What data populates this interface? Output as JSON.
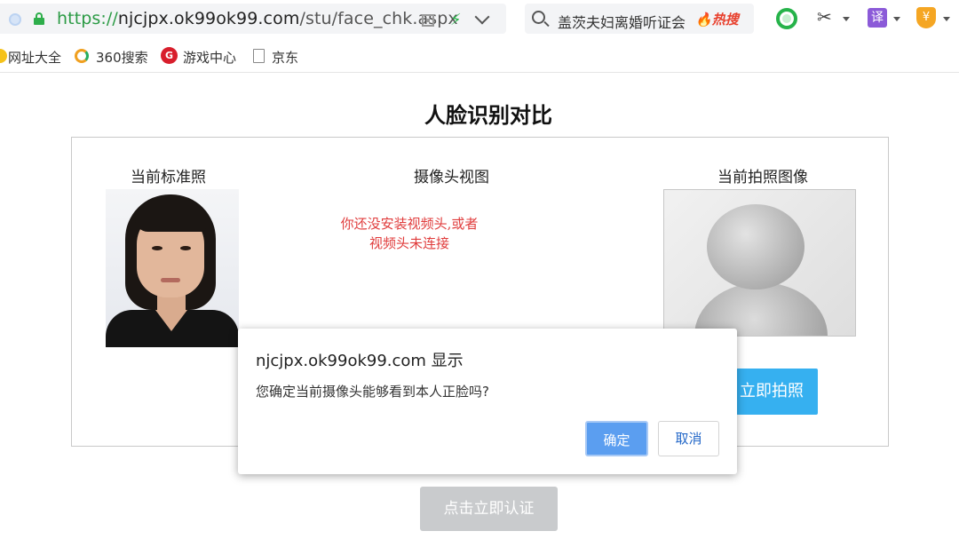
{
  "browser": {
    "url_scheme": "https://",
    "url_host": "njcjpx.ok99ok99.com",
    "url_path": "/stu/face_chk.aspx",
    "search_text": "盖茨夫妇离婚听证会",
    "search_hot": "热搜",
    "translate_label": "译",
    "wallet_label": "¥"
  },
  "bookmarks": {
    "items": [
      "网址大全",
      "360搜索",
      "游戏中心",
      "京东"
    ],
    "game_icon_letter": "G"
  },
  "page": {
    "title": "人脸识别对比",
    "standard_photo_label": "当前标准照",
    "camera_view_label": "摄像头视图",
    "camera_message_line1": "你还没安装视频头,或者",
    "camera_message_line2": "视频头未连接",
    "current_capture_label": "当前拍照图像",
    "shoot_button": "立即拍照",
    "verify_button": "点击立即认证"
  },
  "dialog": {
    "title": "njcjpx.ok99ok99.com 显示",
    "message": "您确定当前摄像头能够看到本人正脸吗?",
    "ok": "确定",
    "cancel": "取消"
  },
  "colors": {
    "accent_blue": "#36b0f0",
    "error_red": "#e03c3c",
    "secure_green": "#2eae4b"
  }
}
